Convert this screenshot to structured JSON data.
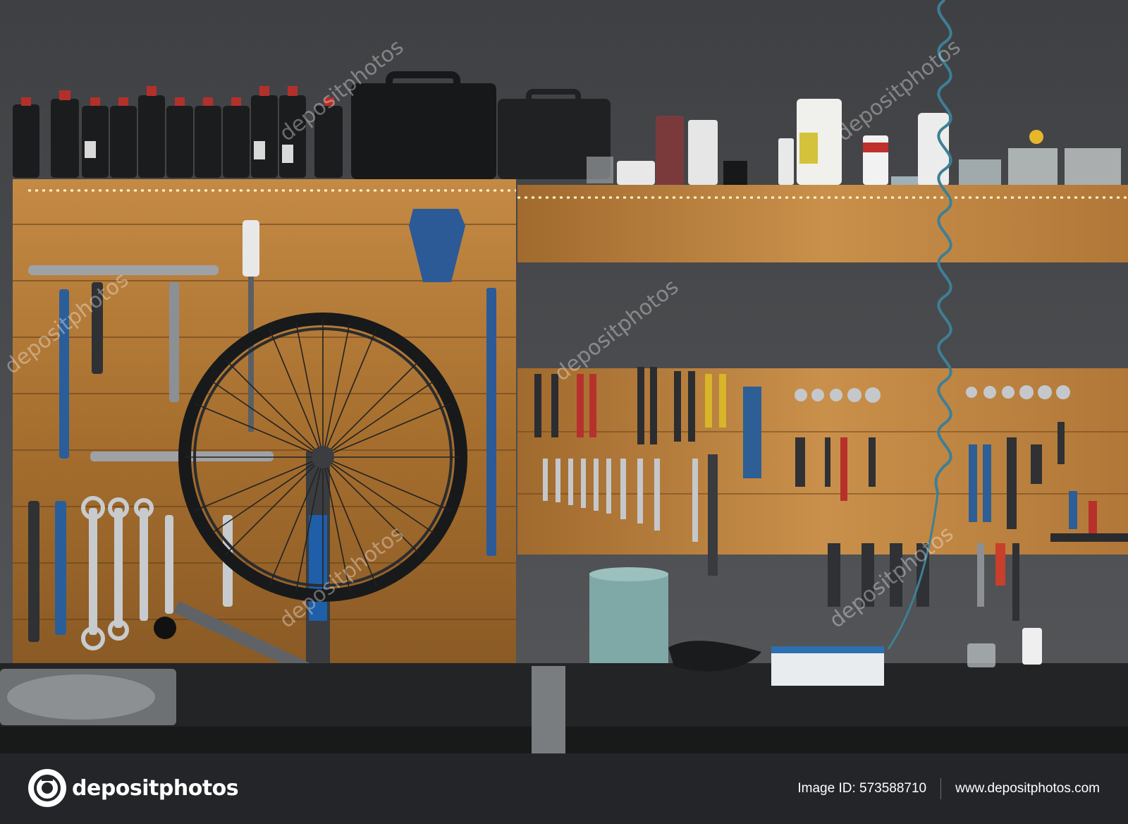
{
  "photo": {
    "subject": "bicycle workshop wall with wheel truing stand and hanging tools",
    "colors": {
      "wall": "#4a4b4e",
      "wood": "#b9813f",
      "bench": "#2b2b2d",
      "spring_hose": "#3d7f95"
    }
  },
  "watermark": {
    "text": "depositphotos"
  },
  "footer": {
    "brand": "depositphotos",
    "image_id": "Image ID: 573588710",
    "site": "www.depositphotos.com",
    "logo_icon": "camera-aperture-icon"
  }
}
